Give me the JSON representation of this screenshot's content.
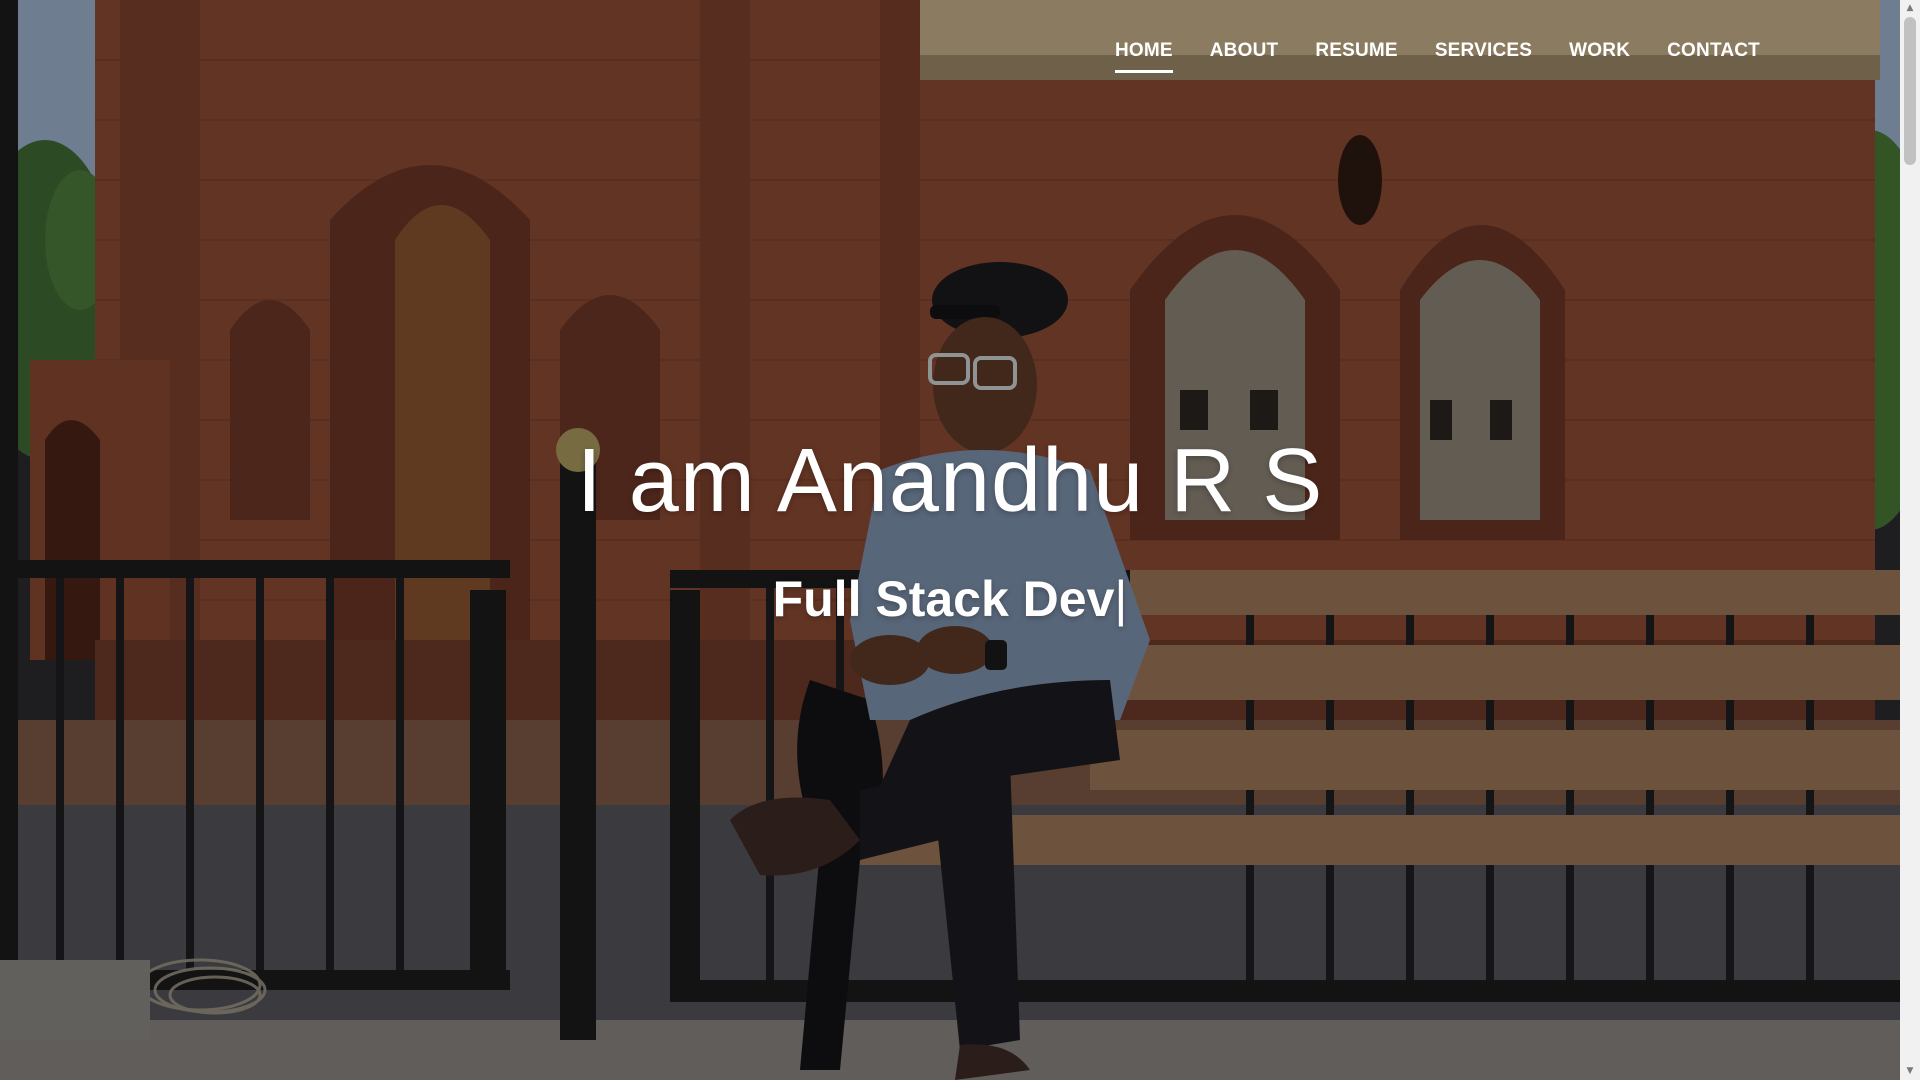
{
  "nav": {
    "items": [
      {
        "label": "HOME",
        "active": true
      },
      {
        "label": "ABOUT",
        "active": false
      },
      {
        "label": "RESUME",
        "active": false
      },
      {
        "label": "SERVICES",
        "active": false
      },
      {
        "label": "WORK",
        "active": false
      },
      {
        "label": "CONTACT",
        "active": false
      }
    ]
  },
  "hero": {
    "title": "I am Anandhu R S",
    "subtitle": "Full Stack Dev",
    "cursor": "|"
  },
  "colors": {
    "text": "#ffffff",
    "overlay": "rgba(0,0,0,0.30)",
    "brick": "#8a4a35"
  },
  "scrollbar": {
    "up_icon": "chevron-up-icon",
    "down_icon": "chevron-down-icon"
  }
}
